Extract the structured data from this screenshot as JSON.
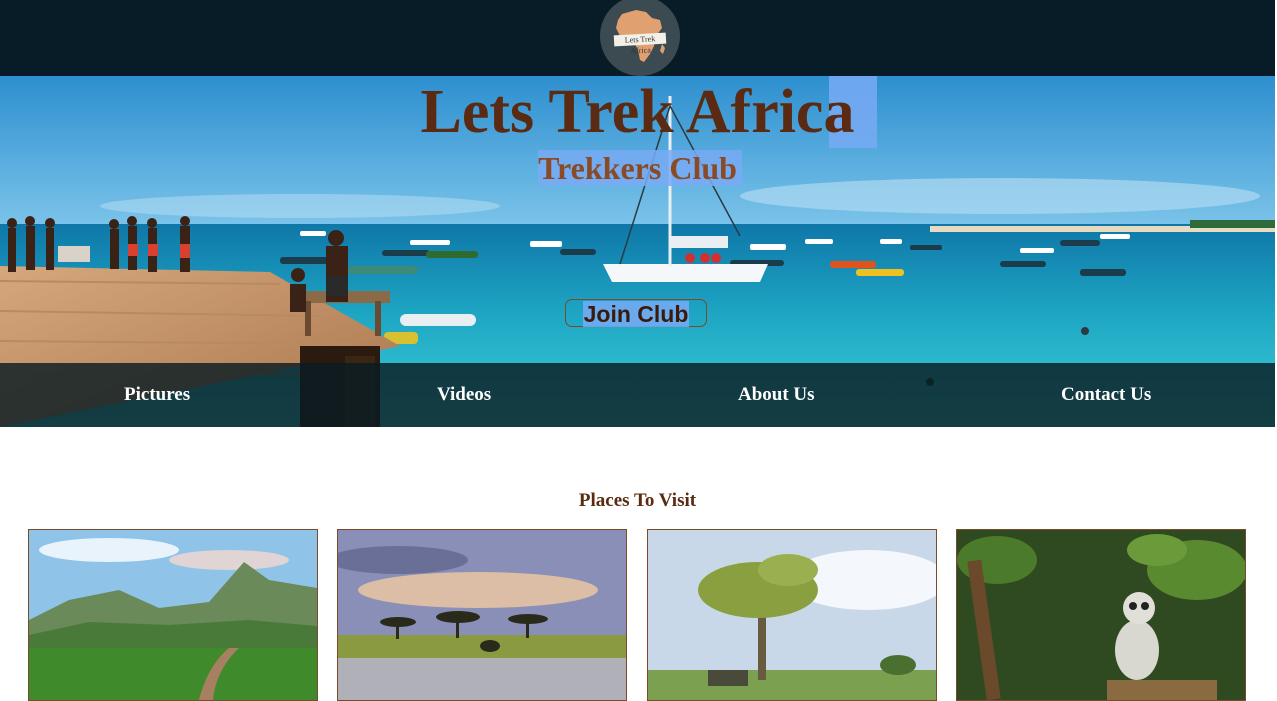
{
  "logo": {
    "text": "Lets Trek Africa",
    "icon": "africa-map-icon"
  },
  "hero": {
    "title": "Lets Trek Africa",
    "subtitle": "Trekkers Club",
    "join_button": "Join Club"
  },
  "nav": {
    "items": [
      {
        "label": "Pictures"
      },
      {
        "label": "Videos"
      },
      {
        "label": "About Us"
      },
      {
        "label": "Contact Us"
      }
    ]
  },
  "places": {
    "title": "Places To Visit",
    "images": [
      "mountain-valley-image",
      "savanna-elephants-image",
      "acacia-safari-image",
      "lemur-image"
    ]
  },
  "colors": {
    "header_bg": "#081c28",
    "brand_brown": "#5a2a12",
    "nav_text": "#ffffff",
    "selection": "#78aaf5"
  }
}
